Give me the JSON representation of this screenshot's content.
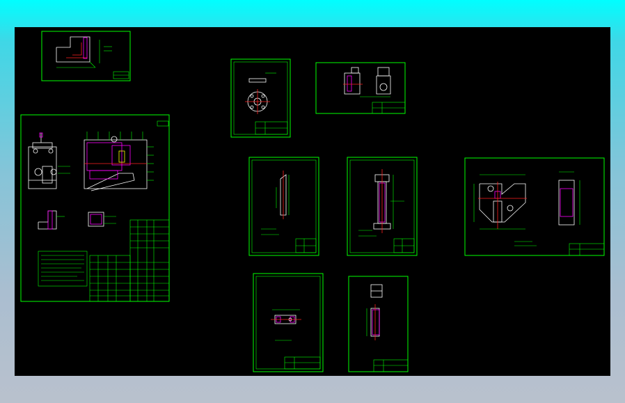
{
  "colors": {
    "top_gradient": "#00ffff",
    "bottom_gradient": "#b9c1cd",
    "canvas": "#000000",
    "line_primary": "#00ff00",
    "line_part": "#ffffff",
    "hatch": "#ff00ff",
    "center_line": "#ff2020"
  },
  "sheets": [
    "assembly-drawing-sheet",
    "l-bracket-sheet",
    "flange-disc-sheet",
    "bracket-view-sheet",
    "thin-pin-sheet",
    "shaft-sheet",
    "angle-plate-sheet",
    "washer-part-sheet",
    "sleeve-part-sheet"
  ]
}
